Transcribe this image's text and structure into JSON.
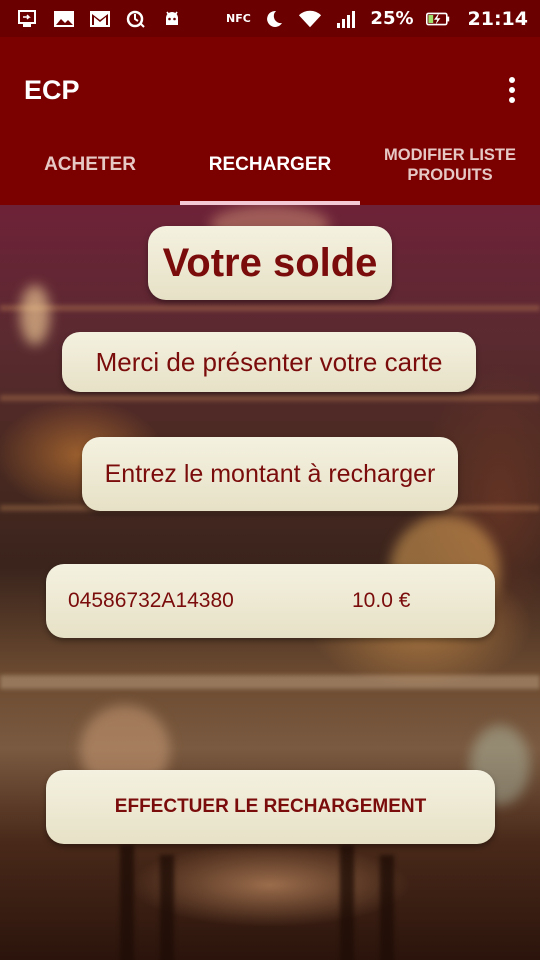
{
  "statusbar": {
    "nfc_label": "NFC",
    "battery_percent": "25%",
    "time": "21:14"
  },
  "app": {
    "title": "ECP"
  },
  "tabs": [
    {
      "label": "ACHETER",
      "active": false
    },
    {
      "label": "RECHARGER",
      "active": true
    },
    {
      "label": "MODIFIER LISTE PRODUITS",
      "active": false
    }
  ],
  "main": {
    "balance_title": "Votre solde",
    "present_card_message": "Merci de présenter votre carte",
    "amount_prompt": "Entrez le montant à recharger",
    "card_id": "04586732A14380",
    "amount_value": "10.0 €",
    "recharge_button_label": "EFFECTUER LE RECHARGEMENT"
  },
  "icons": [
    "usb-debug-icon",
    "image-icon",
    "gmail-icon",
    "sync-icon",
    "android-icon",
    "nfc-icon",
    "moon-icon",
    "wifi-icon",
    "signal-icon",
    "battery-charging-icon",
    "more-vert-icon"
  ],
  "colors": {
    "appbar": "#7b0000",
    "statusbar": "#6a0000",
    "accent_text": "#7b0c0c",
    "tab_indicator": "#f3c9d6",
    "card": "#f4f1e0"
  }
}
